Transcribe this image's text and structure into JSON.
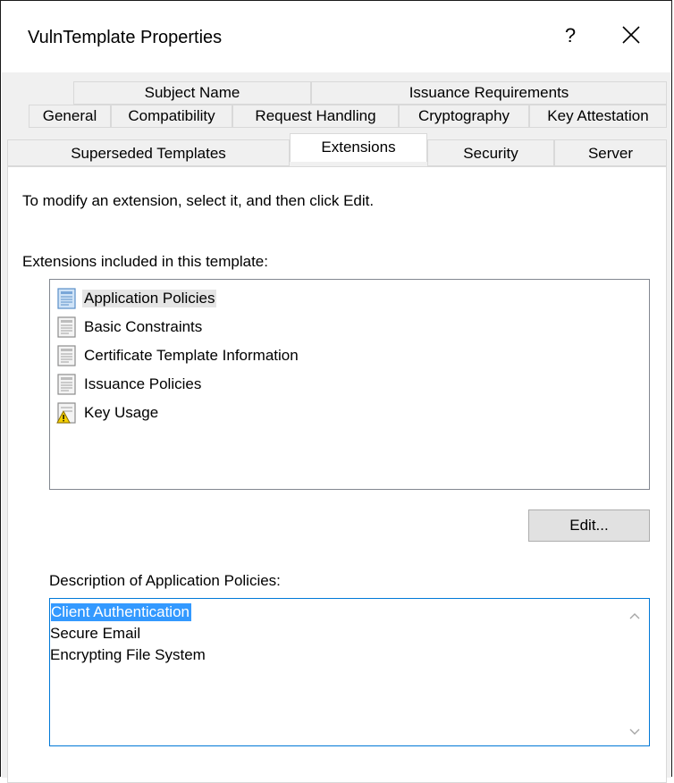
{
  "window": {
    "title": "VulnTemplate Properties",
    "help_label": "?"
  },
  "tabs": {
    "row1": [
      "Subject Name",
      "Issuance Requirements"
    ],
    "row2": [
      "General",
      "Compatibility",
      "Request Handling",
      "Cryptography",
      "Key Attestation"
    ],
    "row3": [
      "Superseded Templates",
      "Extensions",
      "Security",
      "Server"
    ],
    "active": "Extensions"
  },
  "panel": {
    "instruction": "To modify an extension, select it, and then click Edit.",
    "extensions_label": "Extensions included in this template:",
    "extensions": [
      {
        "label": "Application Policies",
        "icon": "extension-icon",
        "selected": true
      },
      {
        "label": "Basic Constraints",
        "icon": "extension-icon"
      },
      {
        "label": "Certificate Template Information",
        "icon": "extension-icon"
      },
      {
        "label": "Issuance Policies",
        "icon": "extension-icon"
      },
      {
        "label": "Key Usage",
        "icon": "extension-warning-icon"
      }
    ],
    "edit_label": "Edit...",
    "description_label": "Description of Application Policies:",
    "description_lines": [
      "Client Authentication",
      "Secure Email",
      "Encrypting File System"
    ]
  },
  "colors": {
    "selection": "#3399ff",
    "focus_border": "#0078d7"
  }
}
